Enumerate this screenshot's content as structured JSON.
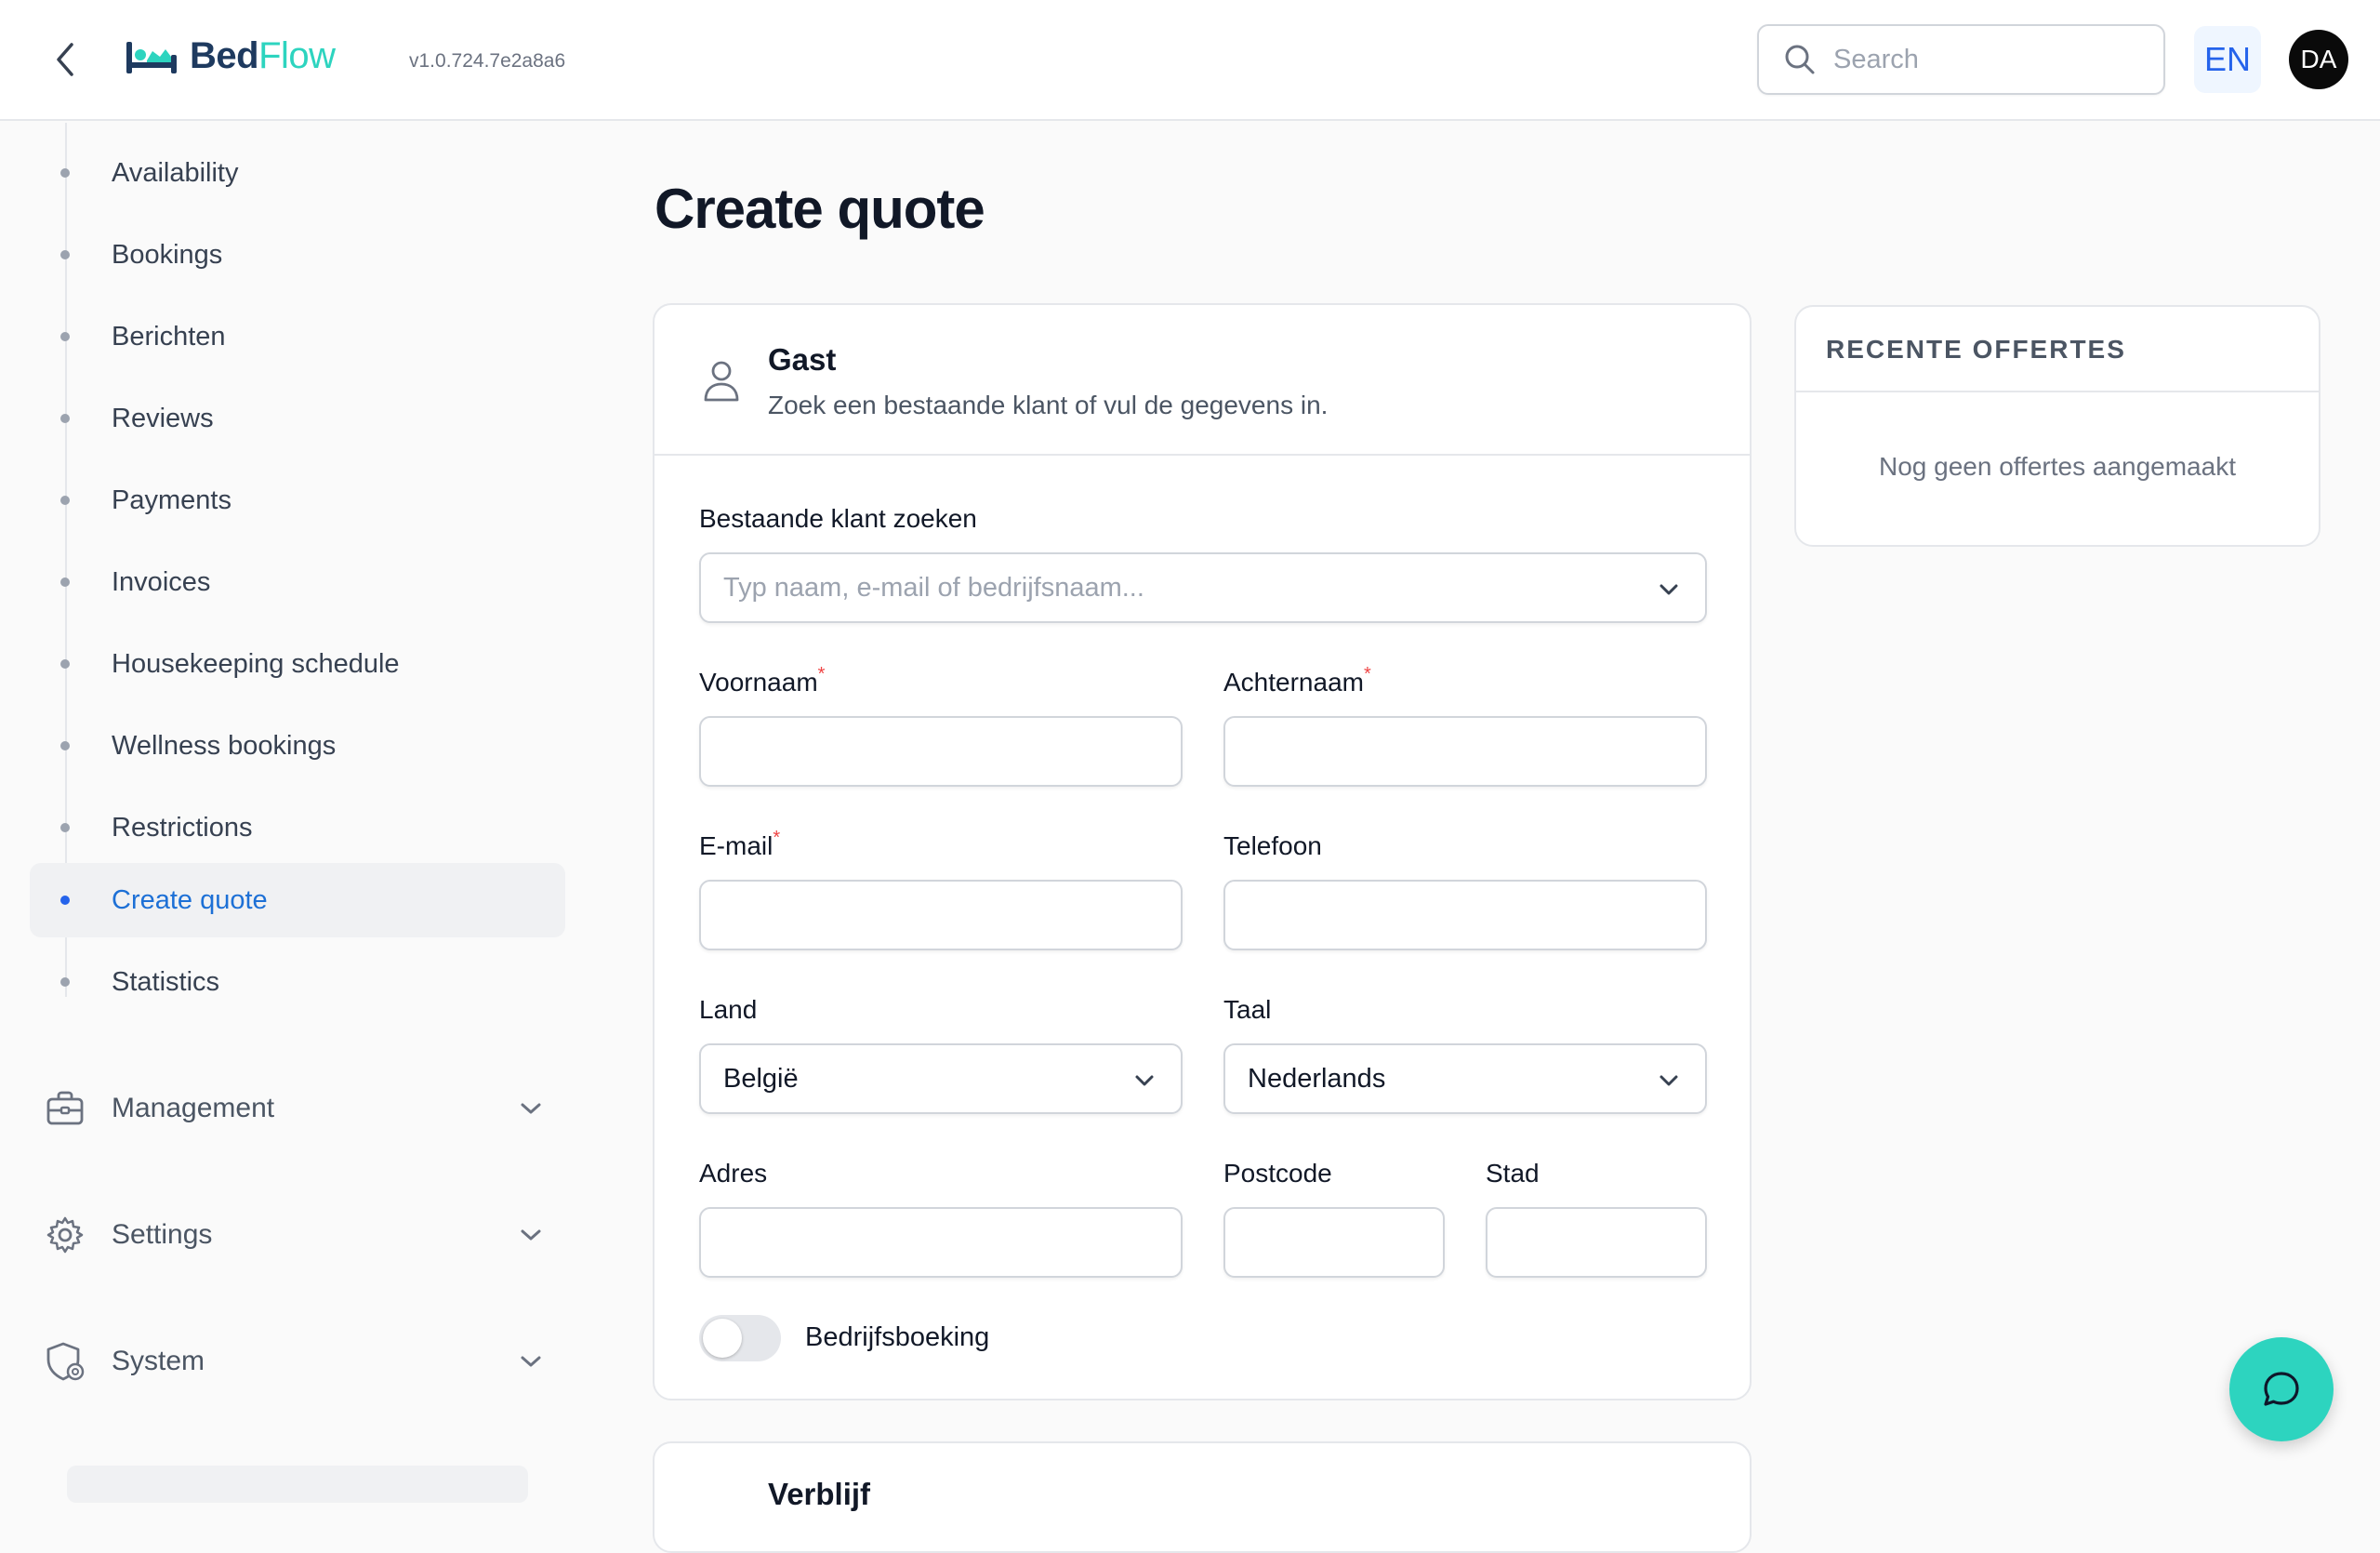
{
  "header": {
    "logo_part1": "Bed",
    "logo_part2": "Flow",
    "version": "v1.0.724.7e2a8a6",
    "search_placeholder": "Search",
    "language": "EN",
    "avatar_initials": "DA"
  },
  "sidebar": {
    "items": [
      {
        "label": "Availability"
      },
      {
        "label": "Bookings"
      },
      {
        "label": "Berichten"
      },
      {
        "label": "Reviews"
      },
      {
        "label": "Payments"
      },
      {
        "label": "Invoices"
      },
      {
        "label": "Housekeeping schedule"
      },
      {
        "label": "Wellness bookings"
      },
      {
        "label": "Restrictions"
      },
      {
        "label": "Create quote",
        "active": true
      },
      {
        "label": "Statistics"
      }
    ],
    "groups": [
      {
        "label": "Management",
        "icon": "briefcase-icon"
      },
      {
        "label": "Settings",
        "icon": "gear-icon"
      },
      {
        "label": "System",
        "icon": "shield-gear-icon"
      }
    ]
  },
  "main": {
    "title": "Create quote",
    "guest": {
      "title": "Gast",
      "subtitle": "Zoek een bestaande klant of vul de gegevens in.",
      "search_label": "Bestaande klant zoeken",
      "search_placeholder": "Typ naam, e-mail of bedrijfsnaam...",
      "first_name_label": "Voornaam",
      "last_name_label": "Achternaam",
      "email_label": "E-mail",
      "phone_label": "Telefoon",
      "country_label": "Land",
      "country_value": "België",
      "language_label": "Taal",
      "language_value": "Nederlands",
      "address_label": "Adres",
      "postcode_label": "Postcode",
      "city_label": "Stad",
      "required_marker": "*",
      "company_toggle_label": "Bedrijfsboeking",
      "company_toggle_on": false
    },
    "second_card_title": "Verblijf"
  },
  "recent_quotes": {
    "title": "RECENTE OFFERTES",
    "empty_text": "Nog geen offertes aangemaakt"
  },
  "colors": {
    "accent": "#2563eb",
    "brand_teal": "#2dd4bf",
    "brand_navy": "#1e3a5f",
    "required": "#ef4444"
  }
}
